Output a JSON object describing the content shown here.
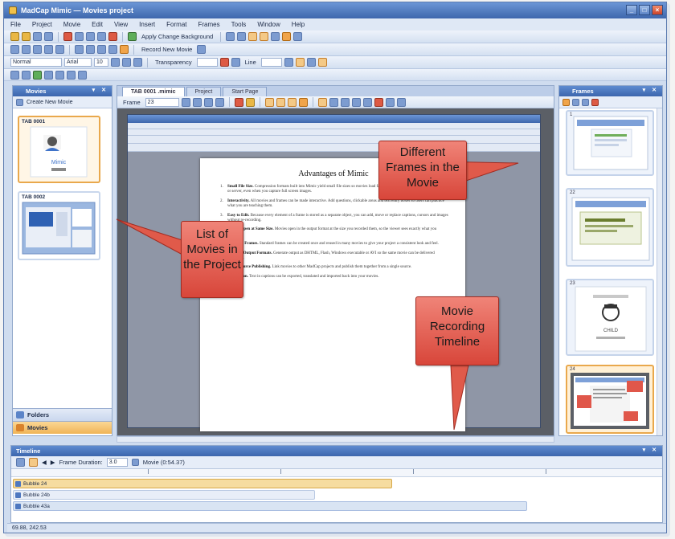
{
  "window": {
    "title": "MadCap Mimic — Movies project"
  },
  "menu": [
    "File",
    "Project",
    "Movie",
    "Edit",
    "View",
    "Insert",
    "Format",
    "Frames",
    "Tools",
    "Window",
    "Help"
  ],
  "toolbar": {
    "style_select": "Normal",
    "font_size": "10",
    "font_label": "Arial",
    "transparency_label": "Transparency",
    "line_label": "Line",
    "change_bg_label": "Apply Change Background",
    "record_label": "Record New Movie"
  },
  "left_panel": {
    "title": "Movies",
    "subtitle": "Create New Movie",
    "movies": [
      {
        "name": "TAB 0001",
        "selected": true
      },
      {
        "name": "TAB 0002",
        "selected": false
      }
    ],
    "nav": [
      {
        "label": "Folders",
        "icon": "folder-icon"
      },
      {
        "label": "Movies",
        "icon": "movie-icon",
        "active": true
      }
    ]
  },
  "center": {
    "tabs": [
      {
        "label": "TAB 0001 .mimic",
        "active": true
      },
      {
        "label": "Project",
        "active": false
      },
      {
        "label": "Start Page",
        "active": false
      }
    ],
    "frame_label": "Frame",
    "frame_value": "23",
    "doc": {
      "title": "Advantages of Mimic",
      "items": [
        {
          "num": "1.",
          "head": "Small File Size.",
          "text": "Compression formats built into Mimic yield small file sizes so movies load fast and take up little room on your hard drive or server, even when you capture full screen images."
        },
        {
          "num": "2.",
          "head": "Interactivity.",
          "text": "All movies and frames can be made interactive. Add questions, clickable areas and text entry boxes so users can practice what you are teaching them."
        },
        {
          "num": "3.",
          "head": "Easy to Edit.",
          "text": "Because every element of a frame is stored as a separate object, you can add, move or replace captions, cursors and images without re-recording."
        },
        {
          "num": "4.",
          "head": "Movies Open at Same Size.",
          "text": "Movies open in the output format at the size you recorded them, so the viewer sees exactly what you captured."
        },
        {
          "num": "5.",
          "head": "Standard Frames.",
          "text": "Standard frames can be created once and reused in many movies to give your project a consistent look and feel."
        },
        {
          "num": "6.",
          "head": "Multiple Output Formats.",
          "text": "Generate output as DHTML, Flash, Windows executable or AVI so the same movie can be delivered anywhere."
        },
        {
          "num": "7.",
          "head": "Single Source Publishing.",
          "text": "Link movies to other MadCap projects and publish them together from a single source."
        },
        {
          "num": "8.",
          "head": "Translation.",
          "text": "Text in captions can be exported, translated and imported back into your movies."
        }
      ]
    }
  },
  "right_panel": {
    "title": "Frames",
    "frames": [
      {
        "num": "1",
        "selected": false
      },
      {
        "num": "22",
        "selected": false
      },
      {
        "num": "23",
        "selected": false
      },
      {
        "num": "24",
        "selected": true
      }
    ]
  },
  "callouts": {
    "frames": "Different Frames in the Movie",
    "movies": "List of Movies in the Project",
    "timeline": "Movie Recording Timeline"
  },
  "timeline": {
    "title": "Timeline",
    "frame_duration_label": "Frame Duration:",
    "frame_duration_value": "3.0",
    "movie_label": "Movie (0:54.37)",
    "tracks": [
      {
        "label": "Bubble 24",
        "color": "#f6dca0",
        "border": "#d6a94a",
        "width_pct": 59
      },
      {
        "label": "Bubble 24b",
        "color": "#e8eef8",
        "border": "#b8c8e2",
        "width_pct": 47
      },
      {
        "label": "Bubble 43a",
        "color": "#d9e4f3",
        "border": "#a8bde0",
        "width_pct": 80
      }
    ]
  },
  "status": {
    "text": "69.88, 242.53"
  }
}
